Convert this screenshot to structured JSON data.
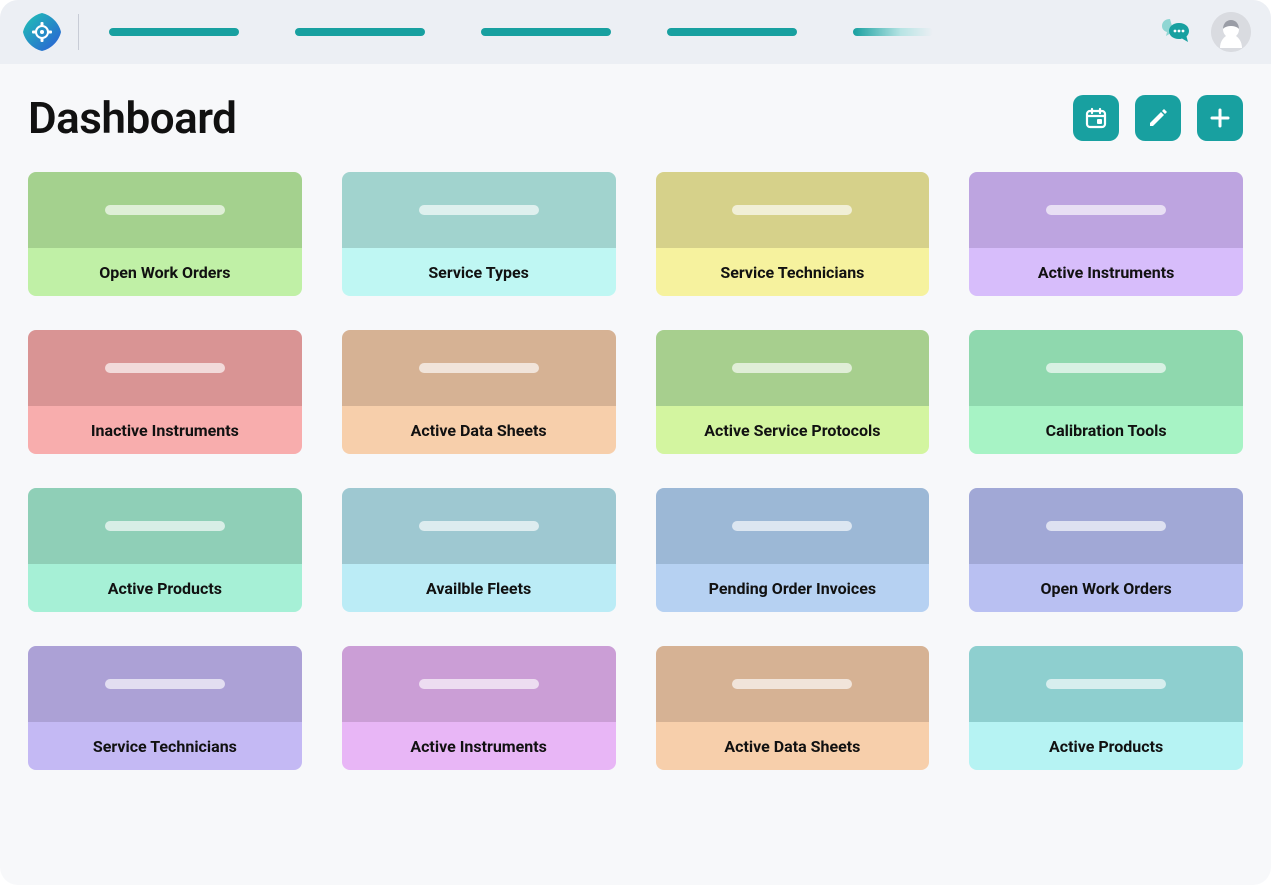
{
  "header": {
    "title": "Dashboard"
  },
  "actions": {
    "calendar_icon": "calendar-icon",
    "edit_icon": "edit-icon",
    "add_icon": "plus-icon",
    "accent_color": "#18a0a0"
  },
  "topbar": {
    "chat_icon": "chat-icon",
    "avatar_icon": "avatar-icon",
    "nav_placeholders": 5
  },
  "cards": [
    {
      "label": "Open Work Orders",
      "top_color": "#a4d18e",
      "bottom_color": "#c0f0a6"
    },
    {
      "label": "Service Types",
      "top_color": "#a1d3ce",
      "bottom_color": "#bff7f3"
    },
    {
      "label": "Service Technicians",
      "top_color": "#d6d18a",
      "bottom_color": "#f6f29e"
    },
    {
      "label": "Active Instruments",
      "top_color": "#bda4e0",
      "bottom_color": "#d7bdfb"
    },
    {
      "label": "Inactive Instruments",
      "top_color": "#d99494",
      "bottom_color": "#f8adad"
    },
    {
      "label": "Active Data Sheets",
      "top_color": "#d6b294",
      "bottom_color": "#f7cfab"
    },
    {
      "label": "Active Service Protocols",
      "top_color": "#a7cf8e",
      "bottom_color": "#d3f5a0"
    },
    {
      "label": "Calibration Tools",
      "top_color": "#8fd8ae",
      "bottom_color": "#a7f3c5"
    },
    {
      "label": "Active Products",
      "top_color": "#8fcfb7",
      "bottom_color": "#a6f0d6"
    },
    {
      "label": "Availble Fleets",
      "top_color": "#9ec8d1",
      "bottom_color": "#bbecf6"
    },
    {
      "label": "Pending Order Invoices",
      "top_color": "#9cb8d6",
      "bottom_color": "#b6d1f2"
    },
    {
      "label": "Open Work Orders",
      "top_color": "#a1a8d6",
      "bottom_color": "#b9c0f2"
    },
    {
      "label": "Service Technicians",
      "top_color": "#aca1d6",
      "bottom_color": "#c4b9f4"
    },
    {
      "label": "Active Instruments",
      "top_color": "#cb9ed6",
      "bottom_color": "#e8b6f6"
    },
    {
      "label": "Active Data Sheets",
      "top_color": "#d6b294",
      "bottom_color": "#f7cfab"
    },
    {
      "label": "Active Products",
      "top_color": "#8ecfcf",
      "bottom_color": "#b6f3f3"
    }
  ]
}
